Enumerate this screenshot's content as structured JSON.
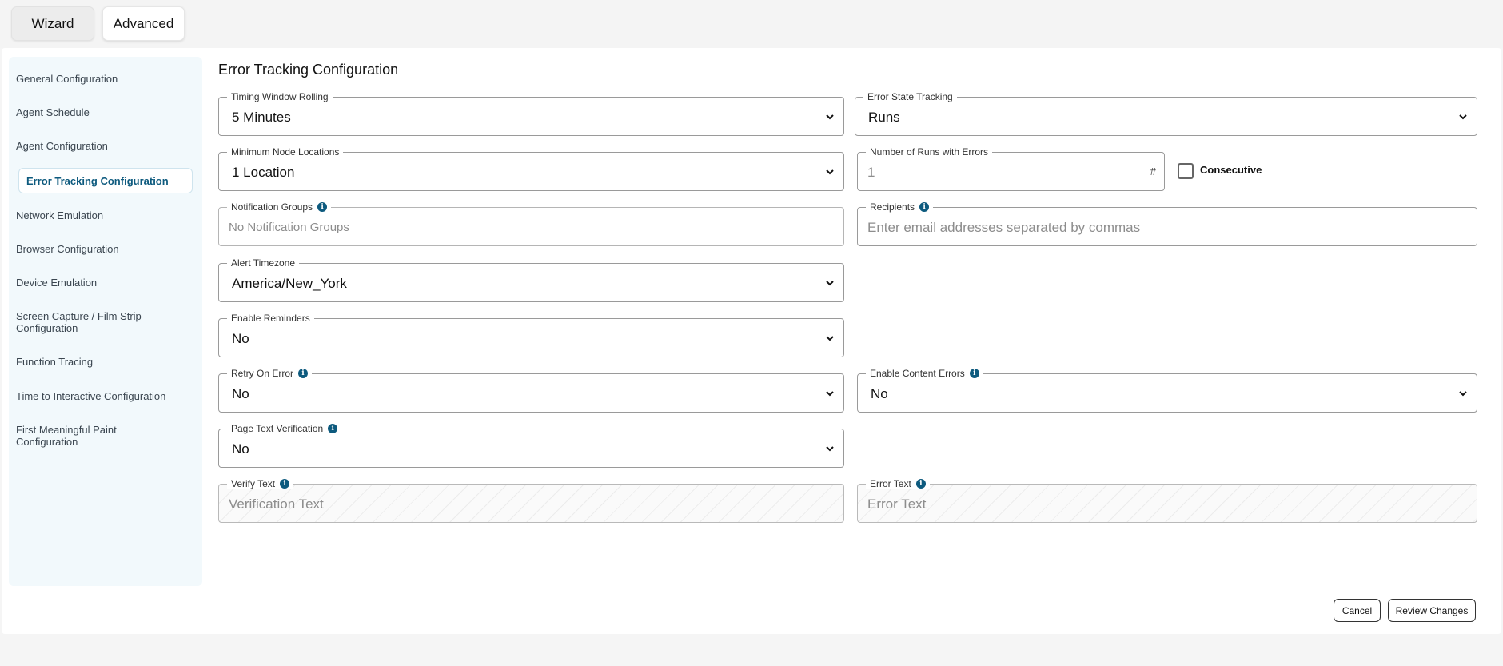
{
  "modes": {
    "wizard": "Wizard",
    "advanced": "Advanced"
  },
  "sidebar": {
    "items": [
      {
        "label": "General Configuration"
      },
      {
        "label": "Agent Schedule"
      },
      {
        "label": "Agent Configuration"
      },
      {
        "label": "Error Tracking Configuration",
        "active": true
      },
      {
        "label": "Network Emulation"
      },
      {
        "label": "Browser Configuration"
      },
      {
        "label": "Device Emulation"
      },
      {
        "label": "Screen Capture / Film Strip Configuration"
      },
      {
        "label": "Function Tracing"
      },
      {
        "label": "Time to Interactive Configuration"
      },
      {
        "label": "First Meaningful Paint Configuration"
      }
    ]
  },
  "main": {
    "title": "Error Tracking Configuration",
    "fields": {
      "timing_window": {
        "label": "Timing Window Rolling",
        "value": "5 Minutes"
      },
      "error_state": {
        "label": "Error State Tracking",
        "value": "Runs"
      },
      "min_nodes": {
        "label": "Minimum Node Locations",
        "value": "1 Location"
      },
      "runs_errors": {
        "label": "Number of Runs with Errors",
        "placeholder": "1",
        "suffix": "#"
      },
      "consecutive": {
        "label": "Consecutive",
        "checked": false
      },
      "notification_groups": {
        "label": "Notification Groups",
        "placeholder": "No Notification Groups"
      },
      "recipients": {
        "label": "Recipients",
        "placeholder": "Enter email addresses separated by commas"
      },
      "alert_timezone": {
        "label": "Alert Timezone",
        "value": "America/New_York"
      },
      "enable_reminders": {
        "label": "Enable Reminders",
        "value": "No"
      },
      "retry_on_error": {
        "label": "Retry On Error",
        "value": "No"
      },
      "enable_content_errors": {
        "label": "Enable Content Errors",
        "value": "No"
      },
      "page_text_verification": {
        "label": "Page Text Verification",
        "value": "No"
      },
      "verify_text": {
        "label": "Verify Text",
        "placeholder": "Verification Text"
      },
      "error_text": {
        "label": "Error Text",
        "placeholder": "Error Text"
      }
    }
  },
  "actions": {
    "cancel": "Cancel",
    "review": "Review Changes"
  },
  "colors": {
    "accent": "#0d5a7e",
    "sidebar_bg": "#f2f9fc"
  },
  "icons": {
    "info": "info-icon",
    "chevron": "chevron-down-icon"
  }
}
